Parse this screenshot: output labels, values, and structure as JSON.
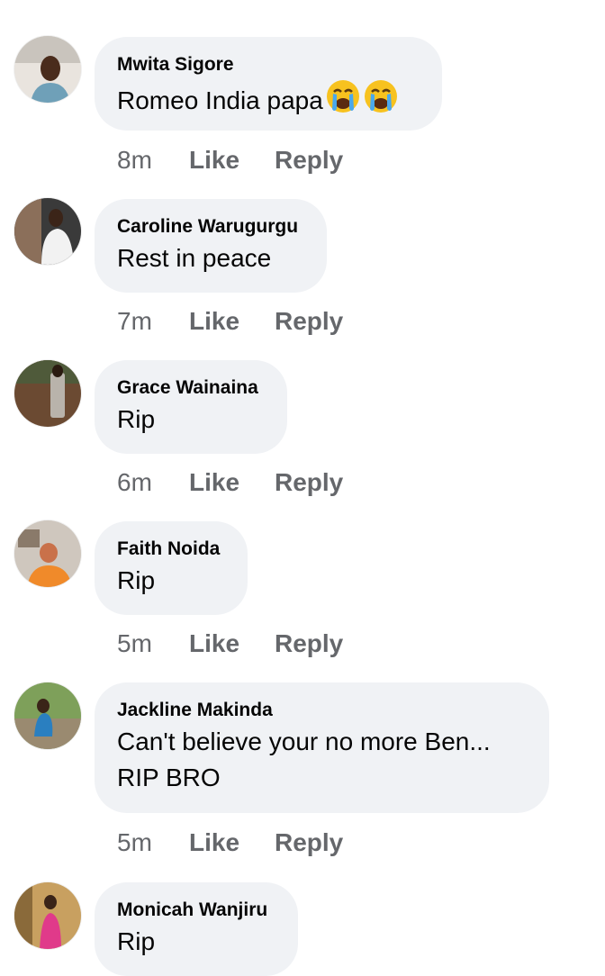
{
  "comments": [
    {
      "author": "Mwita Sigore",
      "text": "Romeo India papa",
      "emoji": "loudly-crying-face",
      "emoji_count": 2,
      "time": "8m",
      "like": "Like",
      "reply": "Reply"
    },
    {
      "author": "Caroline Warugurgu",
      "text": "Rest in peace",
      "time": "7m",
      "like": "Like",
      "reply": "Reply"
    },
    {
      "author": "Grace Wainaina",
      "text": "Rip",
      "time": "6m",
      "like": "Like",
      "reply": "Reply"
    },
    {
      "author": "Faith Noida",
      "text": "Rip",
      "time": "5m",
      "like": "Like",
      "reply": "Reply"
    },
    {
      "author": "Jackline Makinda",
      "text": "Can't believe your no more Ben...",
      "text_line2": "RIP BRO",
      "time": "5m",
      "like": "Like",
      "reply": "Reply"
    },
    {
      "author": "Monicah Wanjiru",
      "text": "Rip"
    }
  ],
  "colors": {
    "bubble_bg": "#f0f2f5",
    "text": "#050505",
    "meta": "#65676b"
  }
}
